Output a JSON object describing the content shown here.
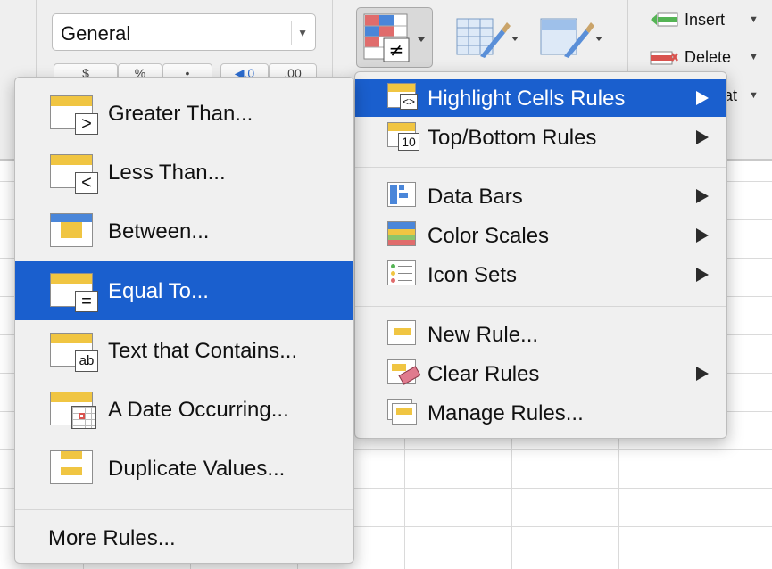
{
  "ribbon": {
    "number_format": {
      "value": "General"
    },
    "number_buttons": [
      "$",
      "%",
      "•",
      "◀.0",
      ".00"
    ],
    "insert_label": "Insert",
    "delete_label": "Delete",
    "format_label": "at"
  },
  "main_menu": {
    "items": [
      {
        "label": "Highlight Cells Rules",
        "icon": "highlight-cells-icon",
        "submenu": true,
        "highlighted": true
      },
      {
        "label": "Top/Bottom Rules",
        "icon": "top-bottom-icon",
        "submenu": true
      },
      {
        "label": "Data Bars",
        "icon": "data-bars-icon",
        "submenu": true
      },
      {
        "label": "Color Scales",
        "icon": "color-scales-icon",
        "submenu": true
      },
      {
        "label": "Icon Sets",
        "icon": "icon-sets-icon",
        "submenu": true
      },
      {
        "label": "New Rule...",
        "icon": "new-rule-icon",
        "submenu": false
      },
      {
        "label": "Clear Rules",
        "icon": "clear-rules-icon",
        "submenu": true
      },
      {
        "label": "Manage Rules...",
        "icon": "manage-rules-icon",
        "submenu": false
      }
    ]
  },
  "highlight_submenu": {
    "items": [
      {
        "label": "Greater Than...",
        "icon": "greater-than-icon",
        "symbol": ">"
      },
      {
        "label": "Less Than...",
        "icon": "less-than-icon",
        "symbol": "<"
      },
      {
        "label": "Between...",
        "icon": "between-icon"
      },
      {
        "label": "Equal To...",
        "icon": "equal-to-icon",
        "symbol": "=",
        "highlighted": true
      },
      {
        "label": "Text that Contains...",
        "icon": "text-contains-icon",
        "symbol": "ab"
      },
      {
        "label": "A Date Occurring...",
        "icon": "date-occurring-icon"
      },
      {
        "label": "Duplicate Values...",
        "icon": "duplicate-values-icon"
      }
    ],
    "more_rules_label": "More Rules..."
  },
  "colors": {
    "highlight": "#1a5fce",
    "cell_yellow": "#f0c542",
    "cell_blue": "#4a86d9",
    "cell_red": "#e06c6c",
    "insert_green": "#55b455",
    "delete_red": "#d9534f"
  }
}
